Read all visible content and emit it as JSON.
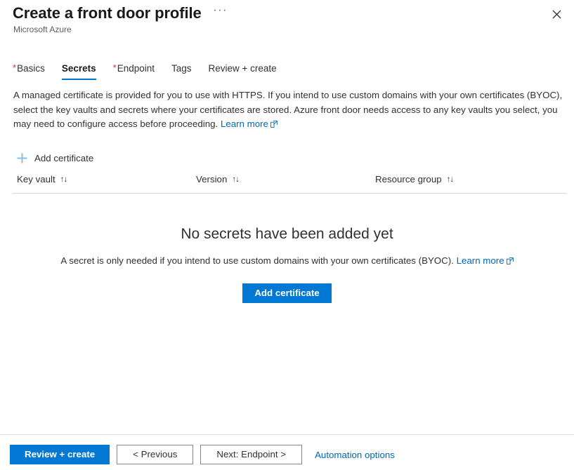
{
  "header": {
    "title": "Create a front door profile",
    "subtitle": "Microsoft Azure",
    "more_menu": "···",
    "close_label": "Close"
  },
  "tabs": [
    {
      "label": "Basics",
      "required": true,
      "active": false
    },
    {
      "label": "Secrets",
      "required": false,
      "active": true
    },
    {
      "label": "Endpoint",
      "required": true,
      "active": false
    },
    {
      "label": "Tags",
      "required": false,
      "active": false
    },
    {
      "label": "Review + create",
      "required": false,
      "active": false
    }
  ],
  "description": {
    "text": "A managed certificate is provided for you to use with HTTPS. If you intend to use custom domains with your own certificates (BYOC), select the key vaults and secrets where your certificates are stored. Azure front door needs access to any key vaults you select, you may need to configure access before proceeding.",
    "learn_more": "Learn more"
  },
  "commandbar": {
    "add_certificate": "Add certificate",
    "plus_icon": "plus-icon"
  },
  "table": {
    "columns": [
      {
        "label": "Key vault",
        "sort": "↑↓"
      },
      {
        "label": "Version",
        "sort": "↑↓"
      },
      {
        "label": "Resource group",
        "sort": "↑↓"
      }
    ],
    "rows": []
  },
  "empty_state": {
    "title": "No secrets have been added yet",
    "description": "A secret is only needed if you intend to use custom domains with your own certificates (BYOC).",
    "learn_more": "Learn more",
    "action_label": "Add certificate"
  },
  "footer": {
    "review_create": "Review + create",
    "previous": "< Previous",
    "next": "Next: Endpoint >",
    "automation_options": "Automation options"
  },
  "colors": {
    "accent": "#0078d4",
    "link": "#0067b8",
    "required_star": "#c4314b",
    "text": "#323130",
    "subtle_text": "#605e5c",
    "divider": "#d6d6d6",
    "plus_icon": "#86bfe8"
  }
}
